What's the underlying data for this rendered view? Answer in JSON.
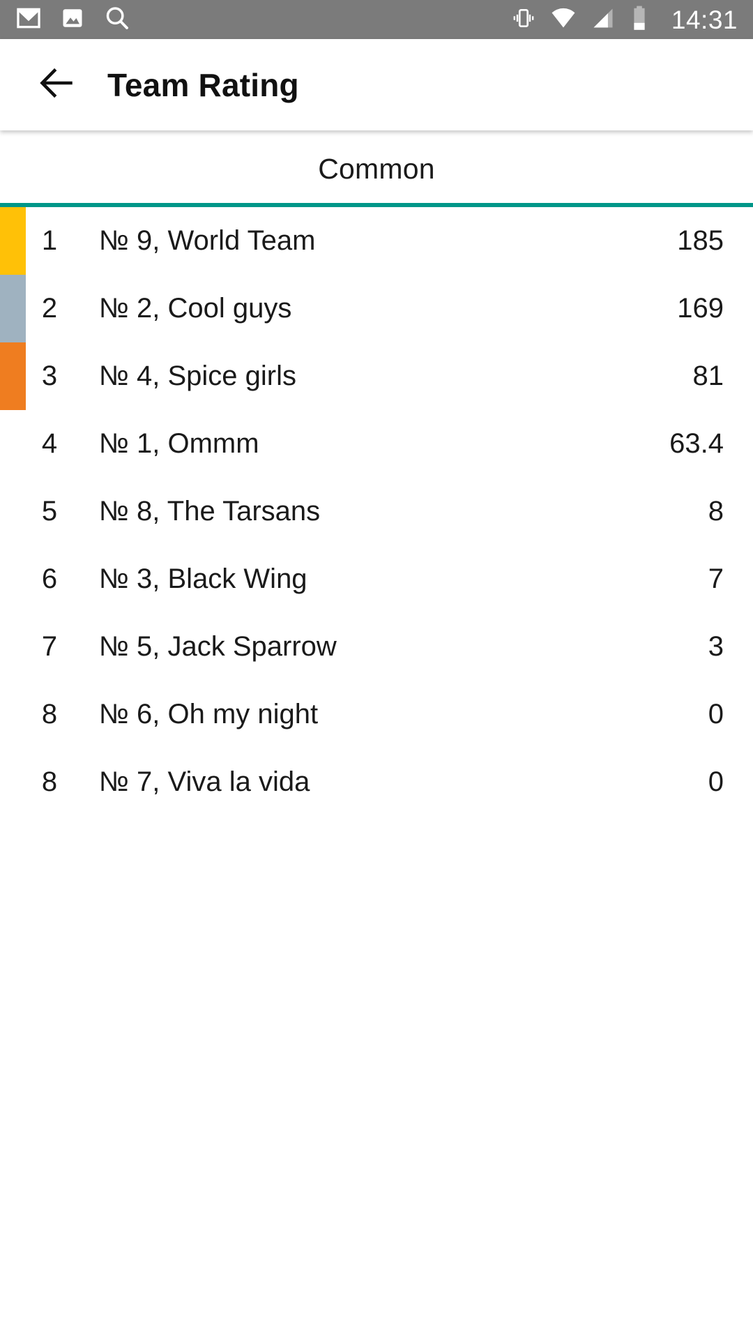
{
  "status_bar": {
    "background": "#7b7b7b",
    "time": "14:31",
    "left_icons": [
      "mail-icon",
      "image-icon",
      "search-icon"
    ],
    "right_icons": [
      "vibrate-icon",
      "wifi-icon",
      "cellular-signal-icon",
      "battery-icon"
    ]
  },
  "toolbar": {
    "back_icon": "back-arrow-icon",
    "title": "Team Rating"
  },
  "tabs": {
    "indicator_color": "#009688",
    "items": [
      {
        "label": "Common",
        "selected": true
      }
    ]
  },
  "list": {
    "medal_colors": {
      "gold": "#FFC107",
      "silver": "#9FB2C0",
      "bronze": "#EF7D20"
    },
    "rows": [
      {
        "rank": "1",
        "team": "№ 9, World Team",
        "score": "185",
        "medal": "gold"
      },
      {
        "rank": "2",
        "team": "№ 2, Cool guys",
        "score": "169",
        "medal": "silver"
      },
      {
        "rank": "3",
        "team": "№ 4, Spice girls",
        "score": "81",
        "medal": "bronze"
      },
      {
        "rank": "4",
        "team": "№ 1, Ommm",
        "score": "63.4",
        "medal": "none"
      },
      {
        "rank": "5",
        "team": "№ 8, The Tarsans",
        "score": "8",
        "medal": "none"
      },
      {
        "rank": "6",
        "team": "№ 3, Black Wing",
        "score": "7",
        "medal": "none"
      },
      {
        "rank": "7",
        "team": "№ 5, Jack Sparrow",
        "score": "3",
        "medal": "none"
      },
      {
        "rank": "8",
        "team": "№ 6, Oh my night",
        "score": "0",
        "medal": "none"
      },
      {
        "rank": "8",
        "team": "№ 7, Viva la vida",
        "score": "0",
        "medal": "none"
      }
    ]
  }
}
